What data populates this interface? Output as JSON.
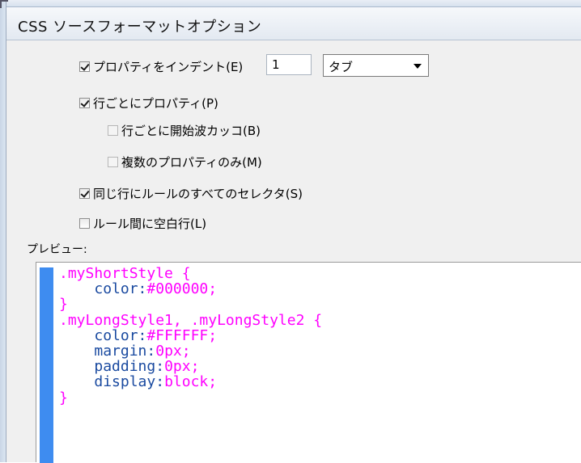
{
  "window": {
    "title": "CSS ソースフォーマットオプション"
  },
  "options": {
    "indent_properties": {
      "label": "プロパティをインデント(E)",
      "checked": true,
      "amount": "1",
      "type": "タブ"
    },
    "property_per_line": {
      "label": "行ごとにプロパティ(P)",
      "checked": true
    },
    "open_brace_per_line": {
      "label": "行ごとに開始波カッコ(B)",
      "checked": false
    },
    "multiple_properties_only": {
      "label": "複数のプロパティのみ(M)",
      "checked": false
    },
    "selectors_same_line": {
      "label": "同じ行にルールのすべてのセレクタ(S)",
      "checked": true
    },
    "blank_line_between_rules": {
      "label": "ルール間に空白行(L)",
      "checked": false
    }
  },
  "preview": {
    "label": "プレビュー:",
    "lines": [
      {
        "kind": "selector",
        "text": ".myShortStyle {"
      },
      {
        "kind": "decl",
        "prop": "color",
        "value": "#000000;"
      },
      {
        "kind": "close",
        "text": "}"
      },
      {
        "kind": "selector",
        "text": ".myLongStyle1, .myLongStyle2 {"
      },
      {
        "kind": "decl",
        "prop": "color",
        "value": "#FFFFFF;"
      },
      {
        "kind": "decl",
        "prop": "margin",
        "value": "0px;"
      },
      {
        "kind": "decl",
        "prop": "padding",
        "value": "0px;"
      },
      {
        "kind": "decl",
        "prop": "display",
        "value": "block;"
      },
      {
        "kind": "close",
        "text": "}"
      }
    ]
  }
}
